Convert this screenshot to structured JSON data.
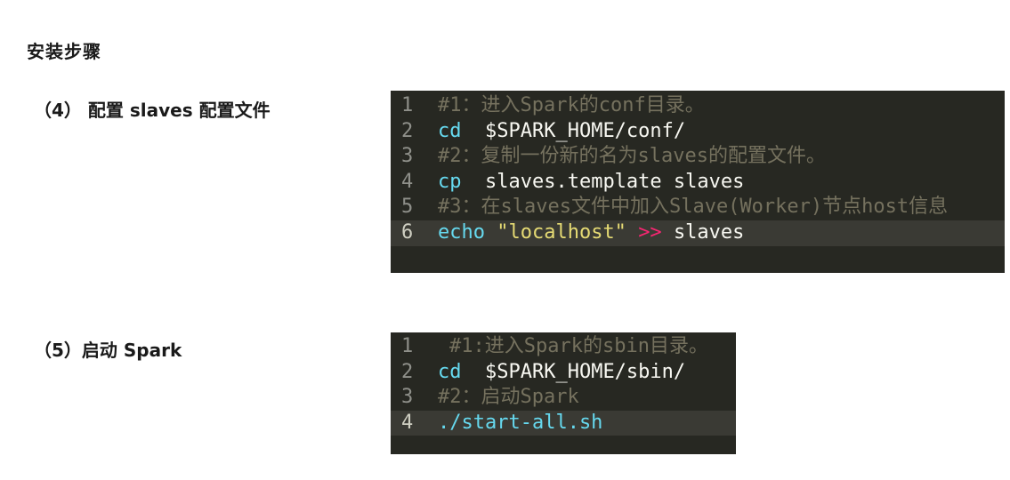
{
  "title": "安装步骤",
  "step4": {
    "label": "（4） 配置 slaves 配置文件",
    "lines": [
      {
        "num": "1",
        "comment": "#1：进入Spark的conf目录。"
      },
      {
        "num": "2",
        "cmd": "cd",
        "args": "  $SPARK_HOME/conf/"
      },
      {
        "num": "3",
        "comment": "#2：复制一份新的名为slaves的配置文件。"
      },
      {
        "num": "4",
        "cmd": "cp",
        "args": "  slaves.template slaves"
      },
      {
        "num": "5",
        "comment": "#3：在slaves文件中加入Slave(Worker)节点host信息"
      },
      {
        "num": "6",
        "cmd": "echo",
        "str": "\"localhost\"",
        "op": ">>",
        "args": "slaves"
      }
    ]
  },
  "step5": {
    "label": "（5）启动 Spark",
    "lines": [
      {
        "num": "1",
        "comment": "#1:进入Spark的sbin目录。"
      },
      {
        "num": "2",
        "cmd": "cd",
        "args": "  $SPARK_HOME/sbin/"
      },
      {
        "num": "3",
        "comment": "#2：启动Spark"
      },
      {
        "num": "4",
        "cmd": "./start-all.sh"
      }
    ]
  }
}
